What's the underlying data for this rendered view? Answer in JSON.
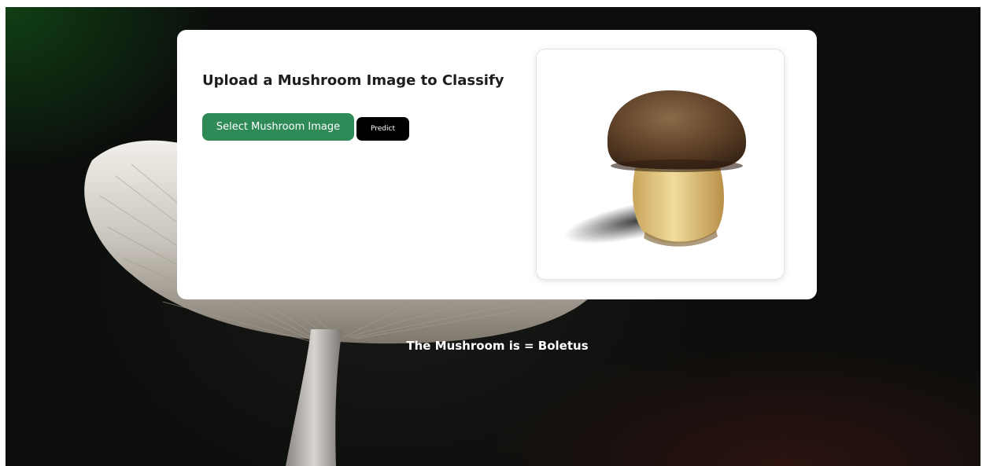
{
  "upload_card": {
    "title": "Upload a Mushroom Image to Classify",
    "select_button_label": "Select Mushroom Image",
    "predict_button_label": "Predict",
    "preview_image": "boletus-mushroom-photo"
  },
  "background_image": "white-mushroom-cap-photo",
  "result": {
    "text": "The Mushroom is = Boletus"
  },
  "colors": {
    "select_button": "#2e8b57",
    "predict_button": "#000000",
    "card_background": "#ffffff",
    "page_background": "#0c0e0c"
  }
}
